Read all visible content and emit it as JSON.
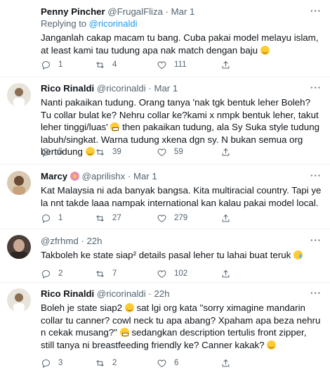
{
  "tweets": [
    {
      "name": "Penny Pincher",
      "handle": "@FrugalFliza",
      "dot": "·",
      "time": "Mar 1",
      "replying_prefix": "Replying to ",
      "replying_handle": "@ricorinaldi",
      "text_before": "Janganlah cakap macam tu bang. Cuba pakai model melayu islam, at least kami tau tudung apa nak match dengan baju ",
      "text_after": "",
      "emoji": "blush",
      "replies": "1",
      "retweets": "4",
      "likes": "111",
      "avatar_color": "#c9a86a"
    },
    {
      "name": "Rico Rinaldi",
      "handle": "@ricorinaldi",
      "dot": "·",
      "time": "Mar 1",
      "text_before": "Nanti pakaikan tudung. Orang tanya 'nak tgk bentuk leher Boleh? Tu collar bulat ke? Nehru collar ke?kami x nmpk bentuk leher, takut leher tinggi/luas' ",
      "text_mid": " then pakaikan tudung, ala Sy Suka style tudung labuh/singkat. Warna tudung xkena dgn sy. N bukan semua org bertudung ",
      "emoji": "grimace",
      "emoji2": "blush",
      "replies": "5",
      "retweets": "39",
      "likes": "59",
      "avatar_color": "#b5a58c"
    },
    {
      "name": "Marcy",
      "handle": "@aprilishx",
      "dot": "·",
      "time": "Mar 1",
      "text_before": "Kat Malaysia ni ada banyak bangsa. Kita multiracial country. Tapi ye la nnt takde laaa nampak international kan kalau pakai model local.",
      "replies": "1",
      "retweets": "27",
      "likes": "279",
      "avatar_color": "#d9b38c"
    },
    {
      "name": "",
      "handle": "@zfrhmd",
      "dot": "·",
      "time": "22h",
      "text_before": "Takboleh ke state siap² details pasal leher tu lahai buat teruk ",
      "emoji": "tear",
      "replies": "2",
      "retweets": "7",
      "likes": "102",
      "avatar_color": "#8a7a6e"
    },
    {
      "name": "Rico Rinaldi",
      "handle": "@ricorinaldi",
      "dot": "·",
      "time": "22h",
      "text_before": "Boleh je state siap2 ",
      "text_mid": " sat lgi org kata \"sorry ximagine mandarin collar tu canner? cowl neck tu apa abang? Xpaham apa beza nehru n cekak musang?\" ",
      "text_after": " sedangkan description tertulis front zipper, still tanya ni breastfeeding friendly ke? Canner kakak? ",
      "emoji": "blush",
      "emoji2": "grimace",
      "emoji3": "blush",
      "replies": "3",
      "retweets": "2",
      "likes": "6",
      "avatar_color": "#b5a58c"
    }
  ],
  "more_label": "···"
}
